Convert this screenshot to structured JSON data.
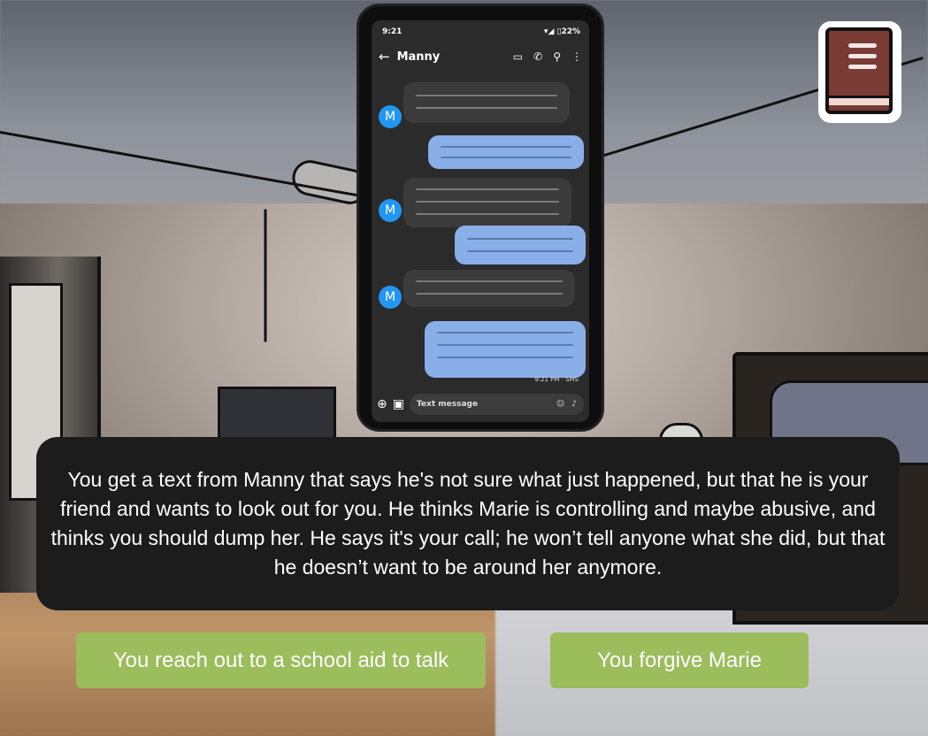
{
  "phone": {
    "status_time": "9:21",
    "status_battery": "▾◢ ▯22%",
    "contact_name": "Manny",
    "avatar_letter": "M",
    "timestamp": "9:21 PM · SMS",
    "composer_placeholder": "Text message"
  },
  "dialogue": {
    "text": "You get a text from Manny that says he's not sure what just happened, but that he is your friend and wants to look out for you.  He thinks Marie is controlling and maybe abusive, and thinks you should dump her.  He says it's your call; he won’t tell anyone what she did, but that he doesn’t want to be around her anymore."
  },
  "choices": [
    {
      "label": "You reach out to a school aid to talk"
    },
    {
      "label": "You forgive Marie"
    }
  ],
  "colors": {
    "choice_button": "#9bbd5c",
    "dialog_bg": "#1c1c1c",
    "outgoing_bubble": "#8aaee8",
    "incoming_bubble": "#3b3b3b",
    "avatar": "#2196f3",
    "journal": "#7a3b35"
  }
}
